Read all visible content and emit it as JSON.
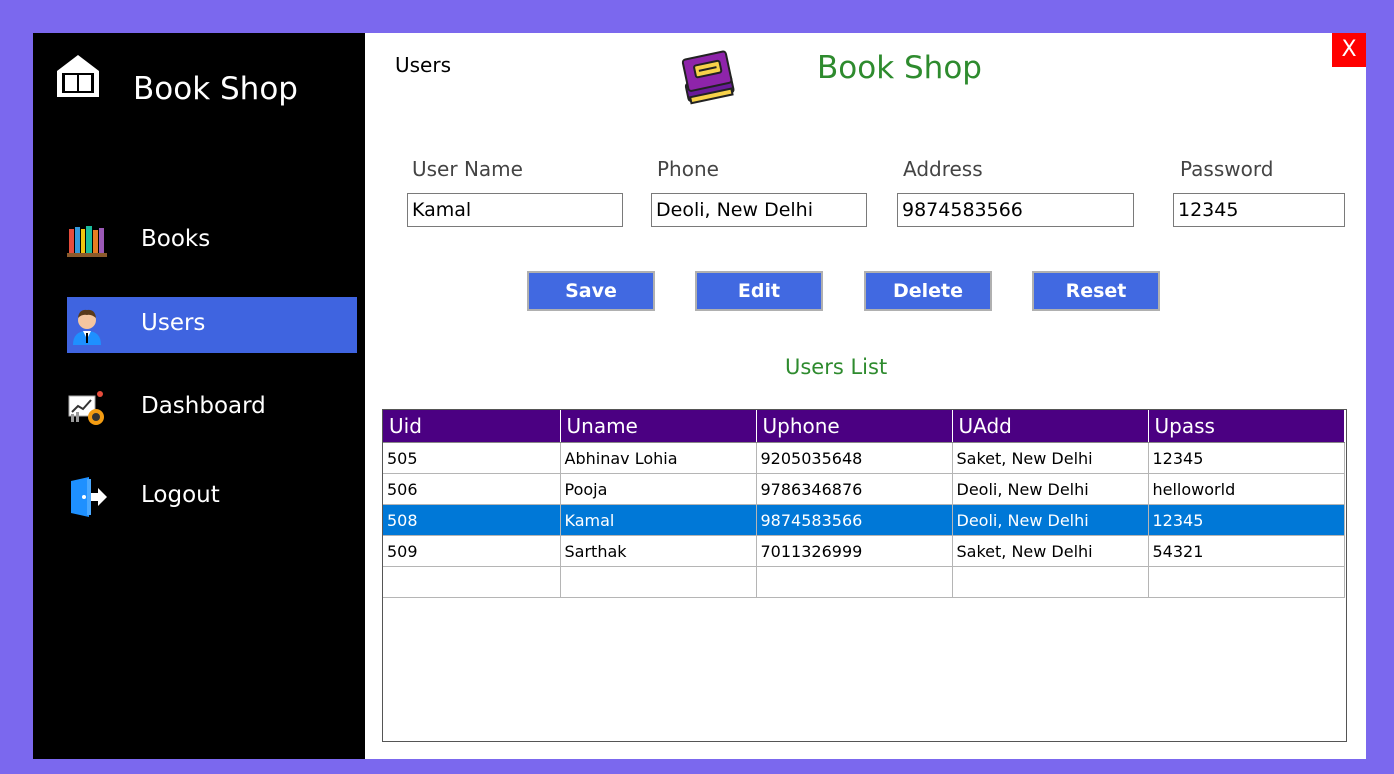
{
  "sidebar": {
    "brand": "Book Shop",
    "items": [
      {
        "label": "Books",
        "icon": "books-icon"
      },
      {
        "label": "Users",
        "icon": "user-icon",
        "active": true
      },
      {
        "label": "Dashboard",
        "icon": "dashboard-icon"
      },
      {
        "label": "Logout",
        "icon": "logout-icon"
      }
    ]
  },
  "header": {
    "page_title": "Users",
    "app_title": "Book Shop",
    "close_label": "X"
  },
  "form": {
    "username": {
      "label": "User Name",
      "value": "Kamal"
    },
    "phone": {
      "label": "Phone",
      "value": "Deoli, New Delhi"
    },
    "address": {
      "label": "Address",
      "value": "9874583566"
    },
    "password": {
      "label": "Password",
      "value": "12345"
    }
  },
  "buttons": {
    "save": "Save",
    "edit": "Edit",
    "delete": "Delete",
    "reset": "Reset"
  },
  "users_list": {
    "title": "Users List",
    "columns": [
      "Uid",
      "Uname",
      "Uphone",
      "UAdd",
      "Upass"
    ],
    "rows": [
      [
        "505",
        "Abhinav Lohia",
        "9205035648",
        "Saket, New Delhi",
        "12345"
      ],
      [
        "506",
        "Pooja",
        "9786346876",
        "Deoli, New Delhi",
        "helloworld"
      ],
      [
        "508",
        "Kamal",
        "9874583566",
        "Deoli, New Delhi",
        "12345"
      ],
      [
        "509",
        "Sarthak",
        "7011326999",
        "Saket, New Delhi",
        "54321"
      ],
      [
        "",
        "",
        "",
        "",
        ""
      ]
    ],
    "selected_row": 2
  },
  "colors": {
    "frame": "#7b68ee",
    "sidebar": "#000000",
    "active_nav": "#3f64e0",
    "button": "#4169e1",
    "title_green": "#2e8b2e",
    "grid_header": "#4b0082",
    "row_selected": "#0078d7",
    "close": "#ff0000"
  }
}
